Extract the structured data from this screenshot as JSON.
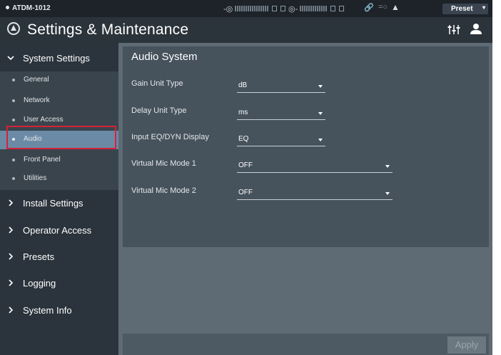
{
  "topbar": {
    "device_name": "ATDM-1012",
    "preset_label": "Preset"
  },
  "header": {
    "title": "Settings & Maintenance"
  },
  "sidebar": {
    "system_settings": {
      "label": "System Settings",
      "items": [
        {
          "label": "General"
        },
        {
          "label": "Network"
        },
        {
          "label": "User Access"
        },
        {
          "label": "Audio"
        },
        {
          "label": "Front Panel"
        },
        {
          "label": "Utilities"
        }
      ]
    },
    "install_settings": "Install Settings",
    "operator_access": "Operator Access",
    "presets": "Presets",
    "logging": "Logging",
    "system_info": "System Info"
  },
  "main": {
    "section_title": "Audio System",
    "fields": [
      {
        "label": "Gain Unit Type",
        "value": "dB"
      },
      {
        "label": "Delay Unit Type",
        "value": "ms"
      },
      {
        "label": "Input EQ/DYN Display",
        "value": "EQ"
      },
      {
        "label": "Virtual Mic Mode 1",
        "value": "OFF"
      },
      {
        "label": "Virtual Mic Mode 2",
        "value": "OFF"
      }
    ],
    "apply_label": "Apply"
  },
  "colors": {
    "sidebar_bg": "#2b343c",
    "active_item": "#6b8aa6",
    "highlight_border": "#d3233a",
    "panel_bg": "#46525c"
  }
}
